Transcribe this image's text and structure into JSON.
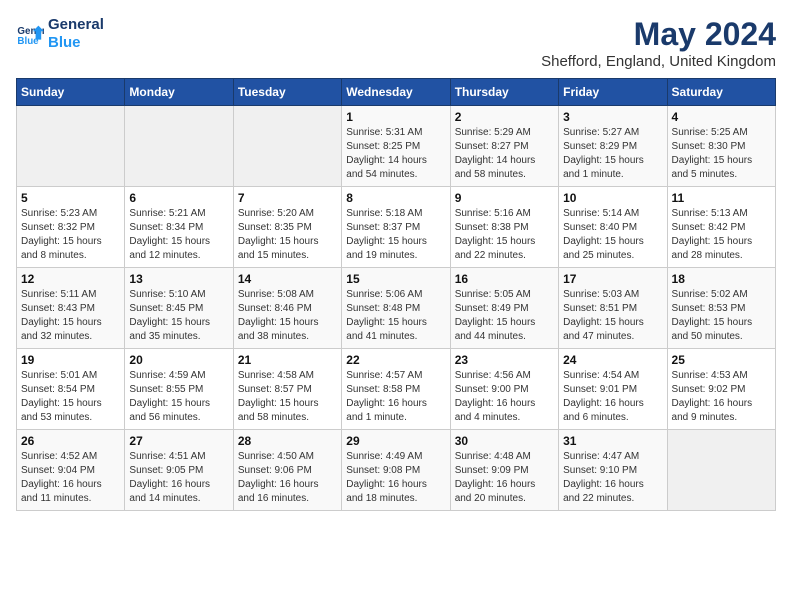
{
  "logo": {
    "line1": "General",
    "line2": "Blue"
  },
  "title": "May 2024",
  "subtitle": "Shefford, England, United Kingdom",
  "days_header": [
    "Sunday",
    "Monday",
    "Tuesday",
    "Wednesday",
    "Thursday",
    "Friday",
    "Saturday"
  ],
  "weeks": [
    [
      {
        "num": "",
        "detail": ""
      },
      {
        "num": "",
        "detail": ""
      },
      {
        "num": "",
        "detail": ""
      },
      {
        "num": "1",
        "detail": "Sunrise: 5:31 AM\nSunset: 8:25 PM\nDaylight: 14 hours\nand 54 minutes."
      },
      {
        "num": "2",
        "detail": "Sunrise: 5:29 AM\nSunset: 8:27 PM\nDaylight: 14 hours\nand 58 minutes."
      },
      {
        "num": "3",
        "detail": "Sunrise: 5:27 AM\nSunset: 8:29 PM\nDaylight: 15 hours\nand 1 minute."
      },
      {
        "num": "4",
        "detail": "Sunrise: 5:25 AM\nSunset: 8:30 PM\nDaylight: 15 hours\nand 5 minutes."
      }
    ],
    [
      {
        "num": "5",
        "detail": "Sunrise: 5:23 AM\nSunset: 8:32 PM\nDaylight: 15 hours\nand 8 minutes."
      },
      {
        "num": "6",
        "detail": "Sunrise: 5:21 AM\nSunset: 8:34 PM\nDaylight: 15 hours\nand 12 minutes."
      },
      {
        "num": "7",
        "detail": "Sunrise: 5:20 AM\nSunset: 8:35 PM\nDaylight: 15 hours\nand 15 minutes."
      },
      {
        "num": "8",
        "detail": "Sunrise: 5:18 AM\nSunset: 8:37 PM\nDaylight: 15 hours\nand 19 minutes."
      },
      {
        "num": "9",
        "detail": "Sunrise: 5:16 AM\nSunset: 8:38 PM\nDaylight: 15 hours\nand 22 minutes."
      },
      {
        "num": "10",
        "detail": "Sunrise: 5:14 AM\nSunset: 8:40 PM\nDaylight: 15 hours\nand 25 minutes."
      },
      {
        "num": "11",
        "detail": "Sunrise: 5:13 AM\nSunset: 8:42 PM\nDaylight: 15 hours\nand 28 minutes."
      }
    ],
    [
      {
        "num": "12",
        "detail": "Sunrise: 5:11 AM\nSunset: 8:43 PM\nDaylight: 15 hours\nand 32 minutes."
      },
      {
        "num": "13",
        "detail": "Sunrise: 5:10 AM\nSunset: 8:45 PM\nDaylight: 15 hours\nand 35 minutes."
      },
      {
        "num": "14",
        "detail": "Sunrise: 5:08 AM\nSunset: 8:46 PM\nDaylight: 15 hours\nand 38 minutes."
      },
      {
        "num": "15",
        "detail": "Sunrise: 5:06 AM\nSunset: 8:48 PM\nDaylight: 15 hours\nand 41 minutes."
      },
      {
        "num": "16",
        "detail": "Sunrise: 5:05 AM\nSunset: 8:49 PM\nDaylight: 15 hours\nand 44 minutes."
      },
      {
        "num": "17",
        "detail": "Sunrise: 5:03 AM\nSunset: 8:51 PM\nDaylight: 15 hours\nand 47 minutes."
      },
      {
        "num": "18",
        "detail": "Sunrise: 5:02 AM\nSunset: 8:53 PM\nDaylight: 15 hours\nand 50 minutes."
      }
    ],
    [
      {
        "num": "19",
        "detail": "Sunrise: 5:01 AM\nSunset: 8:54 PM\nDaylight: 15 hours\nand 53 minutes."
      },
      {
        "num": "20",
        "detail": "Sunrise: 4:59 AM\nSunset: 8:55 PM\nDaylight: 15 hours\nand 56 minutes."
      },
      {
        "num": "21",
        "detail": "Sunrise: 4:58 AM\nSunset: 8:57 PM\nDaylight: 15 hours\nand 58 minutes."
      },
      {
        "num": "22",
        "detail": "Sunrise: 4:57 AM\nSunset: 8:58 PM\nDaylight: 16 hours\nand 1 minute."
      },
      {
        "num": "23",
        "detail": "Sunrise: 4:56 AM\nSunset: 9:00 PM\nDaylight: 16 hours\nand 4 minutes."
      },
      {
        "num": "24",
        "detail": "Sunrise: 4:54 AM\nSunset: 9:01 PM\nDaylight: 16 hours\nand 6 minutes."
      },
      {
        "num": "25",
        "detail": "Sunrise: 4:53 AM\nSunset: 9:02 PM\nDaylight: 16 hours\nand 9 minutes."
      }
    ],
    [
      {
        "num": "26",
        "detail": "Sunrise: 4:52 AM\nSunset: 9:04 PM\nDaylight: 16 hours\nand 11 minutes."
      },
      {
        "num": "27",
        "detail": "Sunrise: 4:51 AM\nSunset: 9:05 PM\nDaylight: 16 hours\nand 14 minutes."
      },
      {
        "num": "28",
        "detail": "Sunrise: 4:50 AM\nSunset: 9:06 PM\nDaylight: 16 hours\nand 16 minutes."
      },
      {
        "num": "29",
        "detail": "Sunrise: 4:49 AM\nSunset: 9:08 PM\nDaylight: 16 hours\nand 18 minutes."
      },
      {
        "num": "30",
        "detail": "Sunrise: 4:48 AM\nSunset: 9:09 PM\nDaylight: 16 hours\nand 20 minutes."
      },
      {
        "num": "31",
        "detail": "Sunrise: 4:47 AM\nSunset: 9:10 PM\nDaylight: 16 hours\nand 22 minutes."
      },
      {
        "num": "",
        "detail": ""
      }
    ]
  ]
}
